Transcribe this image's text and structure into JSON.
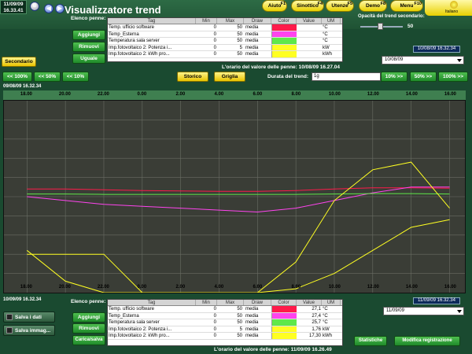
{
  "header": {
    "date": "11/09/09",
    "time": "16.33.41",
    "title": "Visualizzatore trend",
    "logo_text": "Italiano"
  },
  "function_buttons": [
    {
      "label": "Aiuto",
      "key": "F1"
    },
    {
      "label": "Sinottico",
      "key": "F4"
    },
    {
      "label": "Utenze",
      "key": "F5"
    },
    {
      "label": "Demo",
      "key": "F8"
    },
    {
      "label": "Menu",
      "key": "F10"
    }
  ],
  "top_panel": {
    "list_label": "Elenco penne:",
    "buttons": {
      "add": "Aggiungi",
      "remove": "Rimuovi",
      "same": "Uguale"
    },
    "secondary_button": "Secondario",
    "columns": [
      "Tag",
      "Min",
      "Max",
      "Draw",
      "Color",
      "Value",
      "UM"
    ],
    "rows": [
      {
        "tag": "Temp. ufficio software",
        "min": "0",
        "max": "50",
        "draw": "media",
        "color": "#ff1a4a",
        "value": "",
        "um": "°C"
      },
      {
        "tag": "Temp_Esterna",
        "min": "0",
        "max": "50",
        "draw": "media",
        "color": "#ff44ee",
        "value": "",
        "um": "°C"
      },
      {
        "tag": "Temperatura sala server",
        "min": "0",
        "max": "50",
        "draw": "media",
        "color": "#5fe84a",
        "value": "",
        "um": "°C"
      },
      {
        "tag": "Imp.fotovoltaico 2: Potenza i...",
        "min": "0",
        "max": "5",
        "draw": "media",
        "color": "#ffff22",
        "value": "",
        "um": "kW"
      },
      {
        "tag": "Imp.fotovoltaico 2: kWh pro...",
        "min": "0",
        "max": "50",
        "draw": "media",
        "color": "#ffff22",
        "value": "",
        "um": "kWh"
      }
    ],
    "time_note": "L'orario del valore delle penne: 10/08/09 16.27.04",
    "opacity_label": "Opacità del trend secondario:",
    "opacity_value": "50",
    "datetime_box": "10/08/09 16.32.34",
    "date_select": "10/08/09",
    "storico": "Storico",
    "griglia": "Griglia",
    "duration_label": "Durata del trend:",
    "duration_value": "1g",
    "scroll_left": [
      "<< 100%",
      "<< 50%",
      "<< 10%"
    ],
    "scroll_right": [
      "10% >>",
      "50% >>",
      "100% >>"
    ],
    "start_label": "09/08/09 16.32.34"
  },
  "chart_data": {
    "type": "line",
    "x_ticks_top": [
      "18.00",
      "20.00",
      "22.00",
      "0.00",
      "2.00",
      "4.00",
      "6.00",
      "8.00",
      "10.00",
      "12.00",
      "14.00",
      "16.00"
    ],
    "x_ticks_bottom": [
      "18.00",
      "20.00",
      "22.00",
      "0.00",
      "2.00",
      "4.00",
      "6.00",
      "8.00",
      "10.00",
      "12.00",
      "14.00",
      "16.00"
    ],
    "grid": true,
    "series": [
      {
        "name": "Temp. ufficio software",
        "color": "#ff1a4a",
        "values": [
          27,
          27,
          26.8,
          26.6,
          26.5,
          26.4,
          26.4,
          26.6,
          27,
          27.3,
          27.3,
          27.2
        ]
      },
      {
        "name": "Temp_Esterna",
        "color": "#ff44ee",
        "values": [
          25,
          24,
          23,
          22.5,
          22,
          21.5,
          21,
          22,
          24,
          26,
          27.5,
          27.5
        ]
      },
      {
        "name": "Temperatura sala server",
        "color": "#5fe84a",
        "values": [
          25.7,
          25.7,
          25.6,
          25.6,
          25.6,
          25.6,
          25.6,
          25.6,
          25.7,
          25.8,
          25.8,
          25.7
        ]
      },
      {
        "name": "Imp.fotovoltaico 2: Potenza i...",
        "color": "#ffff22",
        "values": [
          1.1,
          0.3,
          0,
          0,
          0,
          0,
          0,
          0.8,
          2.4,
          3.2,
          3.4,
          2.2
        ]
      },
      {
        "name": "Imp.fotovoltaico 2: kWh pro...",
        "color": "#ffff22",
        "values": [
          10,
          10,
          10,
          0,
          0,
          0,
          0,
          1,
          5,
          11,
          17,
          19
        ]
      }
    ]
  },
  "bottom_panel": {
    "start_label": "10/09/09 16.32.34",
    "list_label": "Elenco penne:",
    "buttons": {
      "add": "Aggiungi",
      "remove": "Rimuovi",
      "load": "Carica/salva"
    },
    "save_data": "Salva i dati",
    "save_image": "Salva immag...",
    "rows": [
      {
        "tag": "Temp. ufficio software",
        "min": "0",
        "max": "50",
        "draw": "media",
        "color": "#ff1a4a",
        "value": "27,1",
        "um": "°C"
      },
      {
        "tag": "Temp_Esterna",
        "min": "0",
        "max": "50",
        "draw": "media",
        "color": "#ff44ee",
        "value": "27,4",
        "um": "°C"
      },
      {
        "tag": "Temperatura sala server",
        "min": "0",
        "max": "50",
        "draw": "media",
        "color": "#5fe84a",
        "value": "25,7",
        "um": "°C"
      },
      {
        "tag": "Imp.fotovoltaico 2: Potenza i...",
        "min": "0",
        "max": "5",
        "draw": "media",
        "color": "#ffff22",
        "value": "1,76",
        "um": "kW"
      },
      {
        "tag": "Imp.fotovoltaico 2: kWh pro...",
        "min": "0",
        "max": "50",
        "draw": "media",
        "color": "#ffff22",
        "value": "17,30",
        "um": "kWh"
      }
    ],
    "time_note": "L'orario del valore delle penne: 11/09/09 16.26.49",
    "datetime_box": "11/09/09 16.32.34",
    "date_select": "11/09/09",
    "statistiche": "Statistiche",
    "modifica": "Modifica registrazione"
  }
}
